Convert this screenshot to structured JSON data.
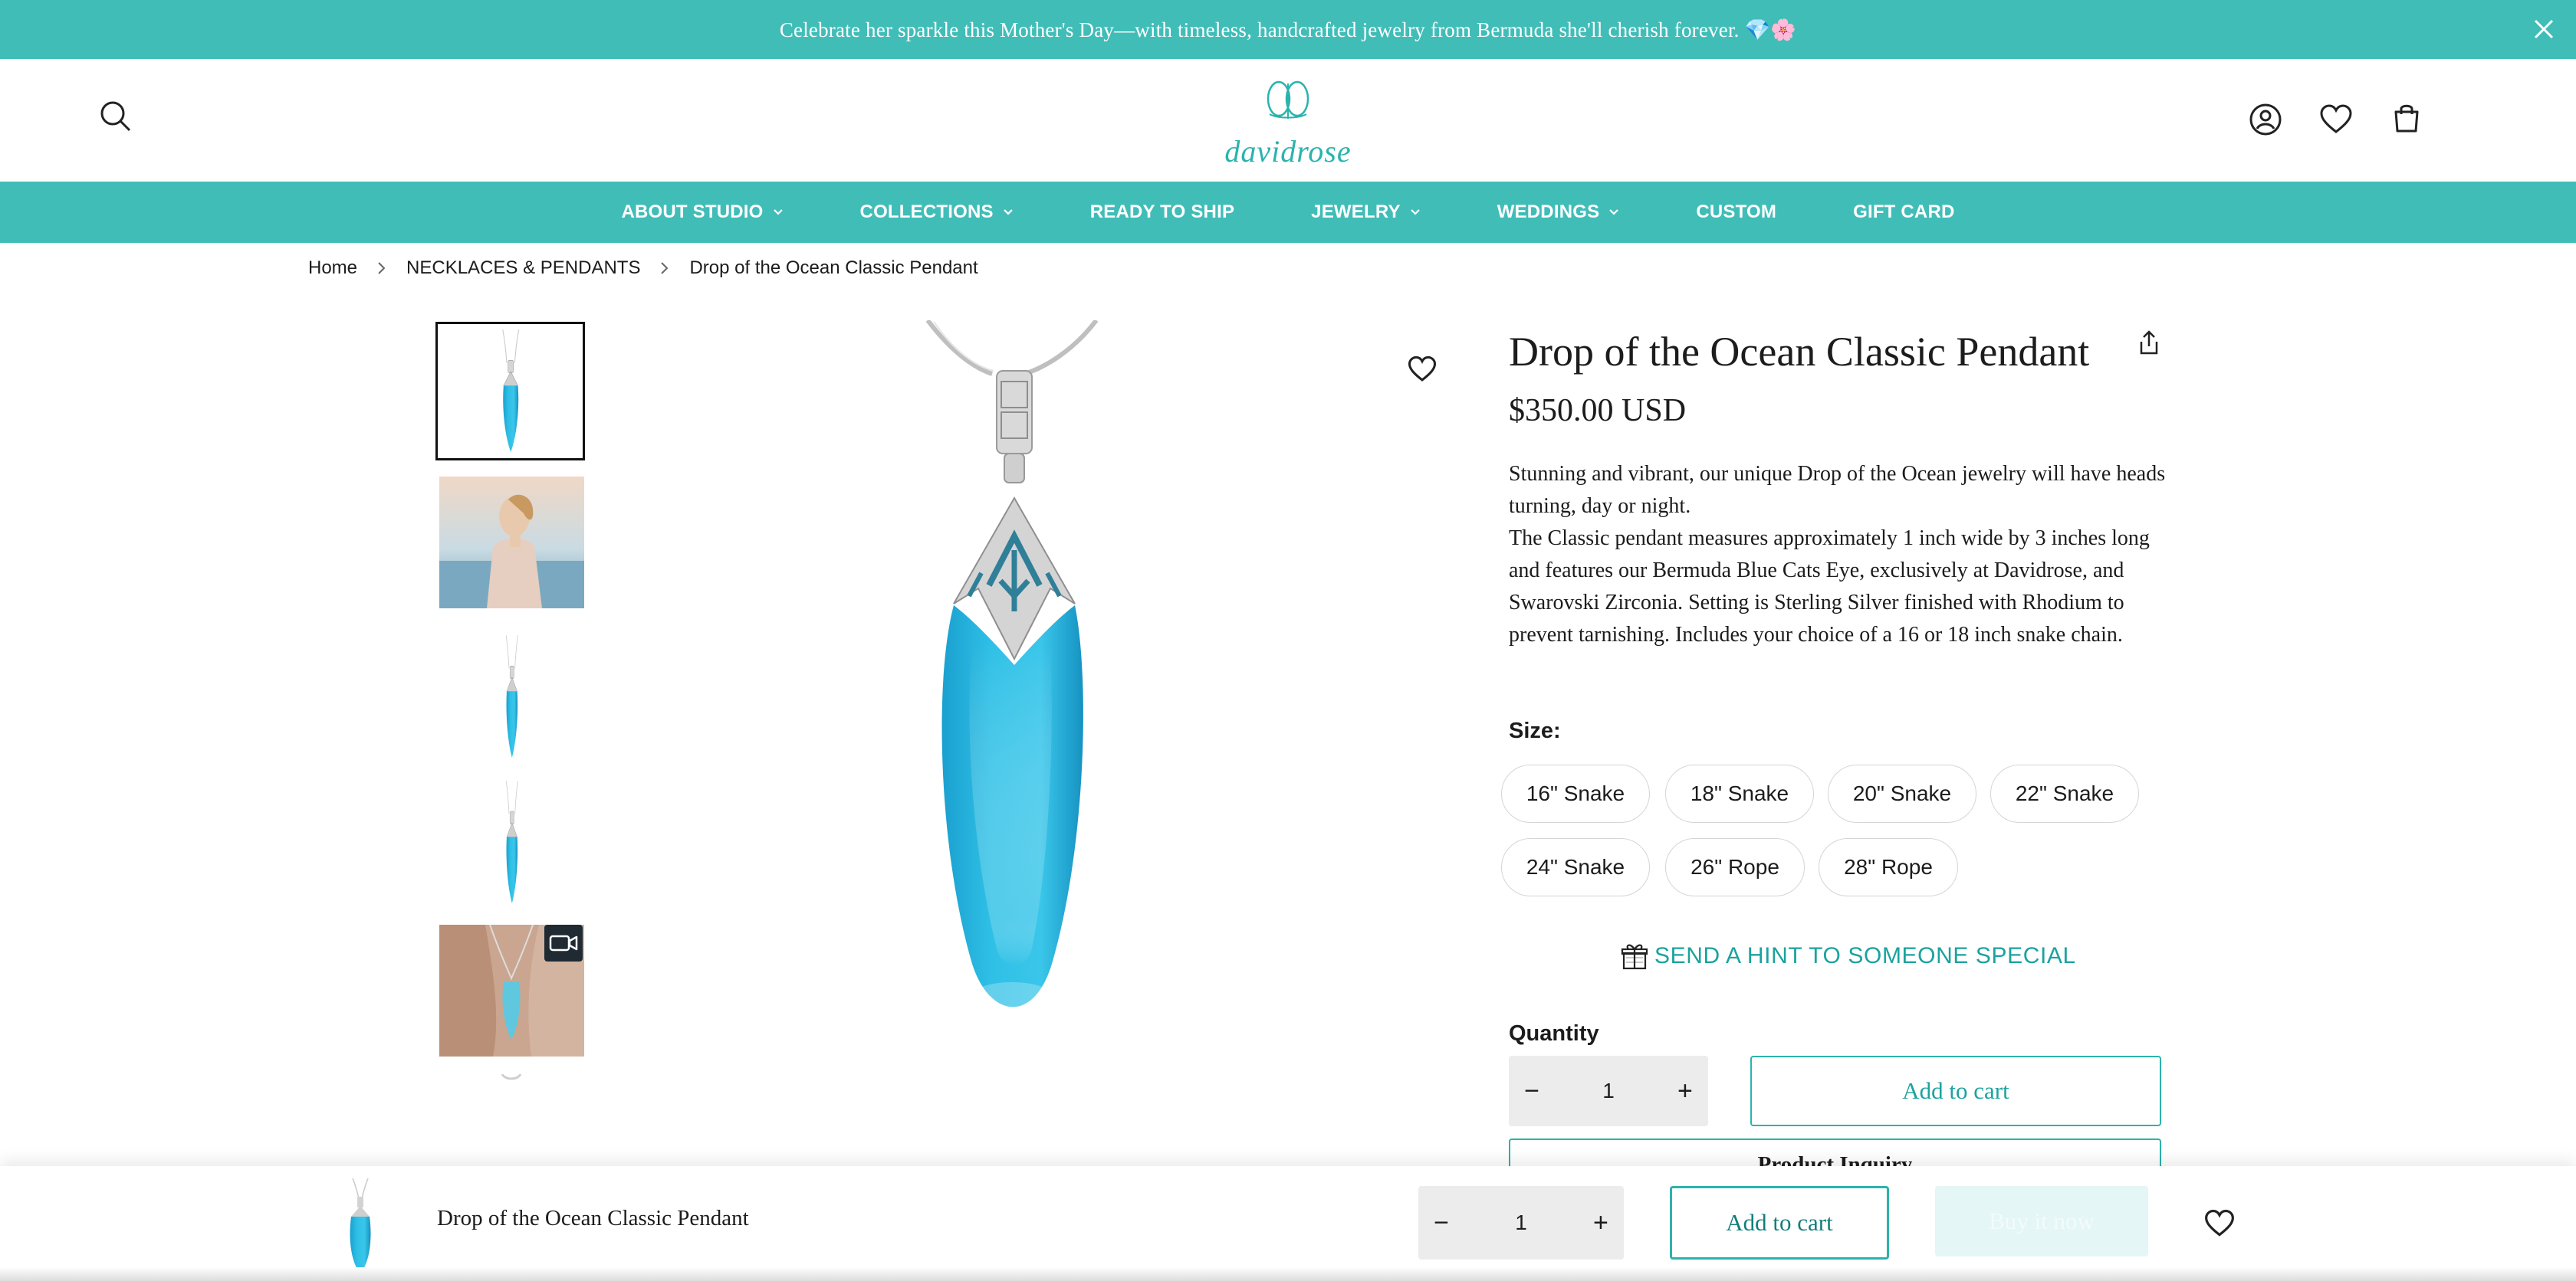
{
  "announcement": {
    "text": "Celebrate her sparkle this Mother's Day—with timeless, handcrafted jewelry from Bermuda she'll cherish forever. 💎🌸"
  },
  "header": {
    "logo_text": "davidrose"
  },
  "nav": {
    "items": [
      {
        "label": "ABOUT STUDIO",
        "dropdown": true
      },
      {
        "label": "COLLECTIONS",
        "dropdown": true
      },
      {
        "label": "READY TO SHIP",
        "dropdown": false
      },
      {
        "label": "JEWELRY",
        "dropdown": true
      },
      {
        "label": "WEDDINGS",
        "dropdown": true
      },
      {
        "label": "CUSTOM",
        "dropdown": false
      },
      {
        "label": "GIFT CARD",
        "dropdown": false
      }
    ]
  },
  "breadcrumb": [
    "Home",
    "NECKLACES & PENDANTS",
    "Drop of the Ocean Classic Pendant"
  ],
  "product": {
    "title": "Drop of the Ocean Classic Pendant",
    "price": "$350.00 USD",
    "description": [
      "Stunning and vibrant, our unique Drop of the Ocean jewelry will have heads turning, day or night.",
      "The Classic pendant measures approximately 1 inch wide by 3 inches long and features our Bermuda Blue Cats Eye, exclusively at Davidrose, and Swarovski Zirconia. Setting is Sterling Silver finished with Rhodium to prevent tarnishing. Includes your choice of a 16 or 18 inch snake chain."
    ],
    "size_label": "Size:",
    "sizes": [
      "16\" Snake",
      "18\" Snake",
      "20\" Snake",
      "22\" Snake",
      "24\" Snake",
      "26\" Rope",
      "28\" Rope"
    ],
    "hint_text": "SEND A HINT TO SOMEONE SPECIAL",
    "quantity_label": "Quantity",
    "quantity": "1",
    "add_to_cart": "Add to cart",
    "inquiry": "Product Inquiry"
  },
  "sticky": {
    "title": "Drop of the Ocean Classic Pendant",
    "quantity": "1",
    "add_to_cart": "Add to cart",
    "buy_now": "Buy it now"
  },
  "colors": {
    "teal": "#41bdb8",
    "teal_text": "#1aa39f",
    "gem": "#29b6dc"
  },
  "icons": [
    "close-icon",
    "search-icon",
    "account-icon",
    "heart-icon",
    "bag-icon",
    "chevron-down-icon",
    "chevron-right-icon",
    "share-icon",
    "gift-icon",
    "video-icon",
    "minus-icon",
    "plus-icon"
  ]
}
